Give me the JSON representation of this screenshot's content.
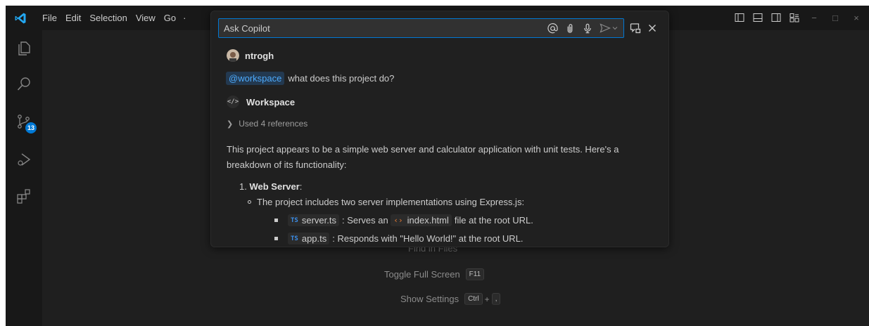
{
  "menu": {
    "items": [
      "File",
      "Edit",
      "Selection",
      "View",
      "Go"
    ],
    "overflow": "·"
  },
  "activity_bar": {
    "icons": [
      "explorer-icon",
      "search-icon",
      "source-control-icon",
      "run-debug-icon",
      "extensions-icon"
    ],
    "source_control_badge": "13"
  },
  "window_controls": {
    "minimize": "−",
    "maximize": "□",
    "close": "×"
  },
  "watermark": {
    "partial_label": "Find in Files",
    "toggle_fullscreen": {
      "label": "Toggle Full Screen",
      "key": "F11"
    },
    "show_settings": {
      "label": "Show Settings",
      "keys": [
        "Ctrl",
        "+",
        ","
      ]
    }
  },
  "chat": {
    "input_placeholder": "Ask Copilot",
    "user": {
      "name": "ntrogh"
    },
    "question": {
      "mention": "@workspace",
      "text": "what does this project do?"
    },
    "agent": {
      "name": "Workspace",
      "icon_glyph": "</>"
    },
    "references": "Used 4 references",
    "answer_intro": "This project appears to be a simple web server and calculator application with unit tests. Here's a breakdown of its functionality:",
    "list": {
      "item1_number": "1.",
      "item1_title": "Web Server",
      "item1_colon": ":",
      "sub1": "The project includes two server implementations using Express.js:",
      "file1": {
        "tag": "TS",
        "name": "server.ts",
        "text_before": ": Serves an",
        "html_name": "index.html",
        "text_after": "file at the root URL."
      },
      "file2": {
        "tag": "TS",
        "name": "app.ts",
        "text_after": ": Responds with \"Hello World!\" at the root URL."
      }
    }
  },
  "colors": {
    "accent": "#0078d4",
    "mention": "#4daafc",
    "background": "#1f1f1f"
  }
}
